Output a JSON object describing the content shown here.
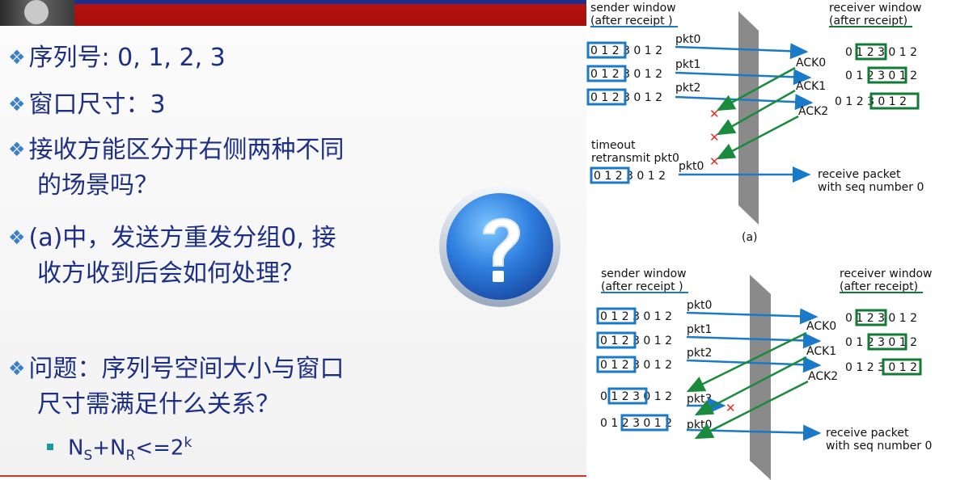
{
  "slide": {
    "bullets": [
      {
        "lines": [
          "序列号: 0, 1, 2, 3"
        ]
      },
      {
        "lines": [
          "窗口尺寸：3"
        ]
      },
      {
        "lines": [
          "接收方能区分开右侧两种不同",
          "的场景吗？"
        ]
      },
      {
        "lines": [
          "(a)中，发送方重发分组0, 接",
          "收方收到后会如何处理？"
        ]
      },
      {
        "lines": [
          "问题：序列号空间大小与窗口",
          "尺寸需满足什么关系？"
        ]
      }
    ],
    "formula": {
      "n": "N",
      "s": "S",
      "plus": "+",
      "r": "R",
      "rest": "<=2",
      "k": "k"
    }
  },
  "diagram_a": {
    "sender_title": "sender window",
    "sender_subtitle": "(after receipt )",
    "receiver_title": "receiver window",
    "receiver_subtitle": "(after receipt)",
    "sender_rows": [
      "0 1 2 3 0 1 2",
      "0 1 2 3 0 1 2",
      "0 1 2 3 0 1 2"
    ],
    "packets": [
      "pkt0",
      "pkt1",
      "pkt2"
    ],
    "acks": [
      "ACK0",
      "ACK1",
      "ACK2"
    ],
    "receiver_rows": [
      "0 1 2 3 0 1 2",
      "0 1 2 3 0 1 2",
      "0 1 2 3 0 1 2"
    ],
    "timeout_line1": "timeout",
    "timeout_line2": "retransmit pkt0",
    "retransmit_row": "0 1 2 3 0 1 2",
    "retransmit_packet": "pkt0",
    "receive_line1": "receive packet",
    "receive_line2": "with seq number 0",
    "caption": "(a)"
  },
  "diagram_b": {
    "sender_title": "sender window",
    "sender_subtitle": "(after receipt )",
    "receiver_title": "receiver window",
    "receiver_subtitle": "(after receipt)",
    "sender_rows": [
      "0 1 2 3 0 1 2",
      "0 1 2 3 0 1 2",
      "0 1 2 3 0 1 2",
      "0 1 2 3 0 1 2",
      "0 1 2 3 0 1 2"
    ],
    "packets": [
      "pkt0",
      "pkt1",
      "pkt2",
      "pkt3",
      "pkt0"
    ],
    "acks": [
      "ACK0",
      "ACK1",
      "ACK2"
    ],
    "receiver_rows": [
      "0 1 2 3 0 1 2",
      "0 1 2 3 0 1 2",
      "0 1 2 3 0 1 2"
    ],
    "receive_line1": "receive packet",
    "receive_line2": "with seq number 0"
  },
  "colors": {
    "title_bar": "#a50d0b",
    "text": "#1c2e86",
    "bullet": "#3a7fc9",
    "sender_box": "#1b7ac8",
    "receiver_box": "#117a35",
    "arrow_send": "#1b7ac8",
    "arrow_ack": "#1a8a3c",
    "loss": "#e0301e"
  }
}
